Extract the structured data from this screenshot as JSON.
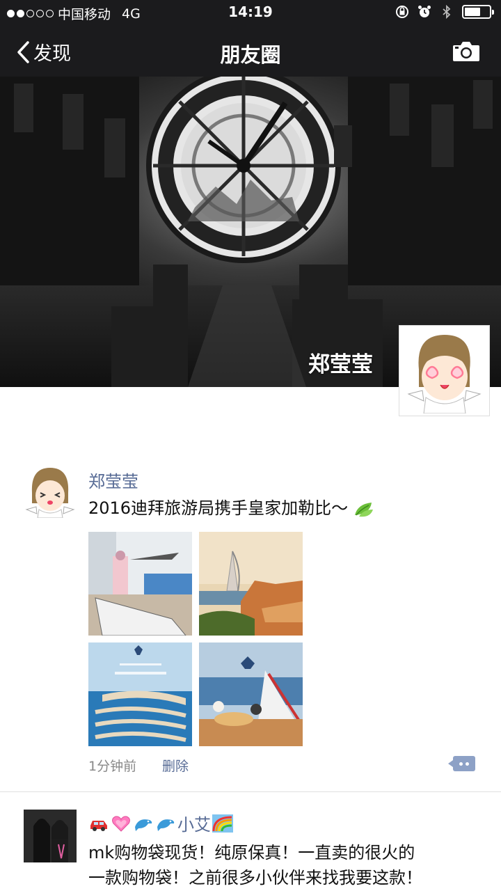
{
  "status_bar": {
    "carrier": "中国移动",
    "network": "4G",
    "time": "14:19"
  },
  "nav": {
    "back_label": "发现",
    "title": "朋友圈"
  },
  "cover": {
    "user_name": "郑莹莹"
  },
  "posts": [
    {
      "author": "郑莹莹",
      "text": "2016迪拜旅游局携手皇家加勒比～",
      "time": "1分钟前",
      "delete_label": "删除"
    },
    {
      "author": "小艾",
      "text_line1": "mk购物袋现货！纯原保真！一直卖的很火的",
      "text_line2": "一款购物袋！之前很多小伙伴来找我要这款！"
    }
  ],
  "colors": {
    "nav_bg": "#1b1b1d",
    "link_blue": "#576b95",
    "muted": "#888888"
  }
}
